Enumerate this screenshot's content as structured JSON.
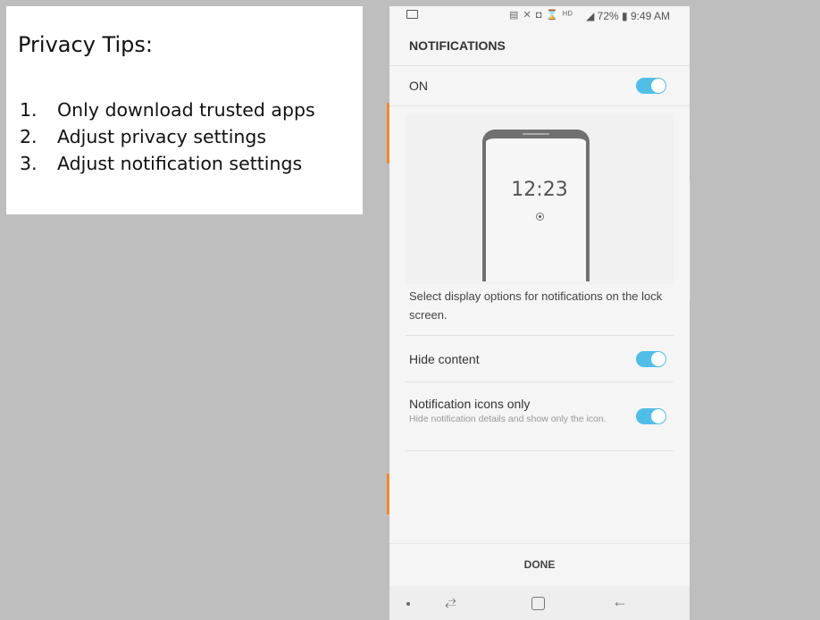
{
  "slide": {
    "title": "Privacy Tips:",
    "tips": [
      {
        "num": "1.",
        "text": "Only download trusted apps"
      },
      {
        "num": "2.",
        "text": "Adjust privacy settings"
      },
      {
        "num": "3.",
        "text": "Adjust notification settings"
      }
    ]
  },
  "phone": {
    "status": {
      "icons": "▤ ✕ ◘ ⌛ ᴴᴰ",
      "signal_battery_time": "◢ 72% ▮ 9:49 AM"
    },
    "header": "NOTIFICATIONS",
    "master_toggle": {
      "label": "ON",
      "on": true
    },
    "preview": {
      "time": "12:23"
    },
    "description": "Select display options for notifications on the lock screen.",
    "hide_content": {
      "label": "Hide content",
      "on": true
    },
    "icons_only": {
      "label": "Notification icons only",
      "sub": "Hide notification details and show only the icon.",
      "on": true
    },
    "done_label": "DONE",
    "nav": {
      "recent": "⥄",
      "back": "←"
    }
  },
  "colors": {
    "toggle_on": "#4fbfe8",
    "accent_orange": "#f0882c",
    "background": "#bebebe"
  }
}
